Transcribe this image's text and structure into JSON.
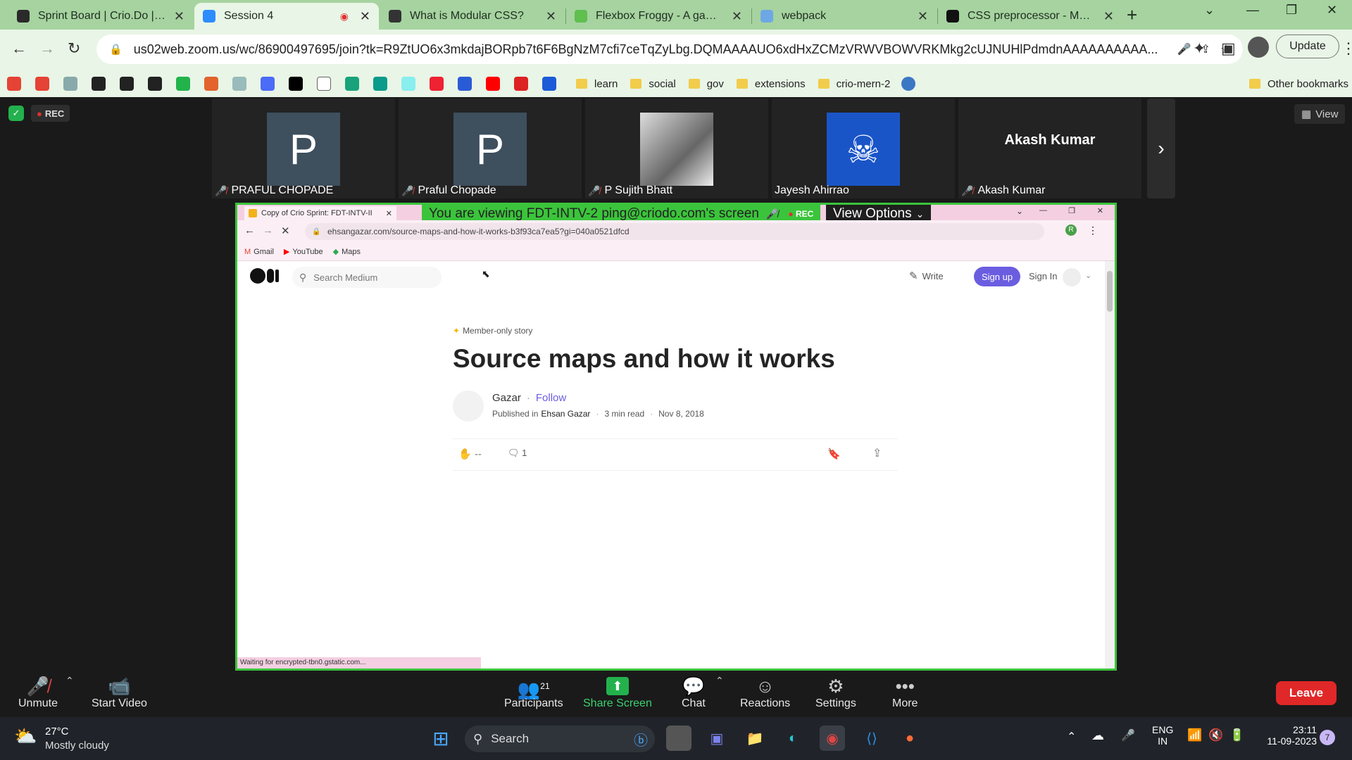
{
  "browser": {
    "tabs": [
      {
        "title": "Sprint Board | Crio.Do | Buil",
        "active": false,
        "fav_color": "#2a2a2a"
      },
      {
        "title": "Session 4",
        "active": true,
        "fav_color": "#2d8cff"
      },
      {
        "title": "What is Modular CSS?",
        "active": false,
        "fav_color": "#333333"
      },
      {
        "title": "Flexbox Froggy - A game fo",
        "active": false,
        "fav_color": "#5fbf4f"
      },
      {
        "title": "webpack",
        "active": false,
        "fav_color": "#6ea8e4"
      },
      {
        "title": "CSS preprocessor - MDN W",
        "active": false,
        "fav_color": "#111111"
      }
    ],
    "url": "us02web.zoom.us/wc/86900497695/join?tk=R9ZtUO6x3mkdajBORpb7t6F6BgNzM7cfi7ceTqZyLbg.DQMAAAAUO6xdHxZCMzVRWVBOWVRKMkg2cUJNUHlPdmdnAAAAAAAAAA...",
    "update_label": "Update",
    "bookmark_folders": [
      "learn",
      "social",
      "gov",
      "extensions",
      "crio-mern-2"
    ],
    "other_bookmarks": "Other bookmarks"
  },
  "zoom": {
    "rec_label": "REC",
    "view_label": "View",
    "participants": [
      {
        "name": "PRAFUL CHOPADE",
        "initial": "P",
        "muted": true
      },
      {
        "name": "Praful Chopade",
        "initial": "P",
        "muted": true
      },
      {
        "name": "P Sujith Bhatt",
        "initial": "",
        "muted": true
      },
      {
        "name": "Jayesh Ahirrao",
        "initial": "",
        "muted": false
      },
      {
        "name": "Akash Kumar",
        "initial": "",
        "muted": true,
        "big_name": "Akash Kumar"
      }
    ],
    "banner": "You are viewing FDT-INTV-2 ping@criodo.com's screen",
    "banner_rec": "REC",
    "view_options": "View Options",
    "toolbar": {
      "unmute": "Unmute",
      "start_video": "Start Video",
      "participants": "Participants",
      "participants_count": "21",
      "share_screen": "Share Screen",
      "chat": "Chat",
      "reactions": "Reactions",
      "settings": "Settings",
      "more": "More",
      "leave": "Leave"
    }
  },
  "shared": {
    "tab_title": "Copy of Crio Sprint: FDT-INTV-II",
    "url": "ehsangazar.com/source-maps-and-how-it-works-b3f93ca7ea5?gi=040a0521dfcd",
    "bookmarks": [
      "Gmail",
      "YouTube",
      "Maps"
    ],
    "status": "Waiting for encrypted-tbn0.gstatic.com...",
    "medium": {
      "search_placeholder": "Search Medium",
      "write": "Write",
      "signup": "Sign up",
      "signin": "Sign In",
      "member_story": "Member-only story",
      "title": "Source maps and how it works",
      "author": "Gazar",
      "follow": "Follow",
      "published_in": "Published in",
      "publication": "Ehsan Gazar",
      "read_time": "3 min read",
      "date": "Nov 8, 2018",
      "claps": "--",
      "comments": "1"
    }
  },
  "taskbar": {
    "temperature": "27°C",
    "weather": "Mostly cloudy",
    "search": "Search",
    "lang1": "ENG",
    "lang2": "IN",
    "time": "23:11",
    "date": "11-09-2023",
    "notif": "7"
  }
}
